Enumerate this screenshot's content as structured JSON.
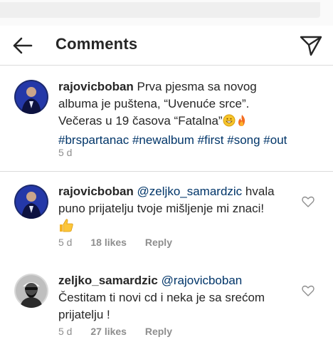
{
  "header": {
    "title": "Comments"
  },
  "caption": {
    "username": "rajovicboban",
    "text": "Prva pjesma sa novog albuma je puštena, “Uvenuće srce”. Večeras u 19 časova “Fatalna”",
    "hashtags": [
      "#brspartanac",
      "#newalbum",
      "#first",
      "#song",
      "#out"
    ],
    "time": "5 d"
  },
  "comments": [
    {
      "username": "rajovicboban",
      "mention": "@zeljko_samardzic",
      "text": "hvala puno prijatelju tvoje mišljenje mi znaci!",
      "time": "5 d",
      "likes": "18 likes",
      "reply": "Reply"
    },
    {
      "username": "zeljko_samardzic",
      "mention": "@rajovicboban",
      "text": "Čestitam ti novi cd i neka je sa srećom prijatelju !",
      "time": "5 d",
      "likes": "27 likes",
      "reply": "Reply"
    }
  ],
  "colors": {
    "link": "#003569",
    "muted": "#8e8e8e",
    "text": "#262626",
    "divider": "#dbdbdb"
  }
}
